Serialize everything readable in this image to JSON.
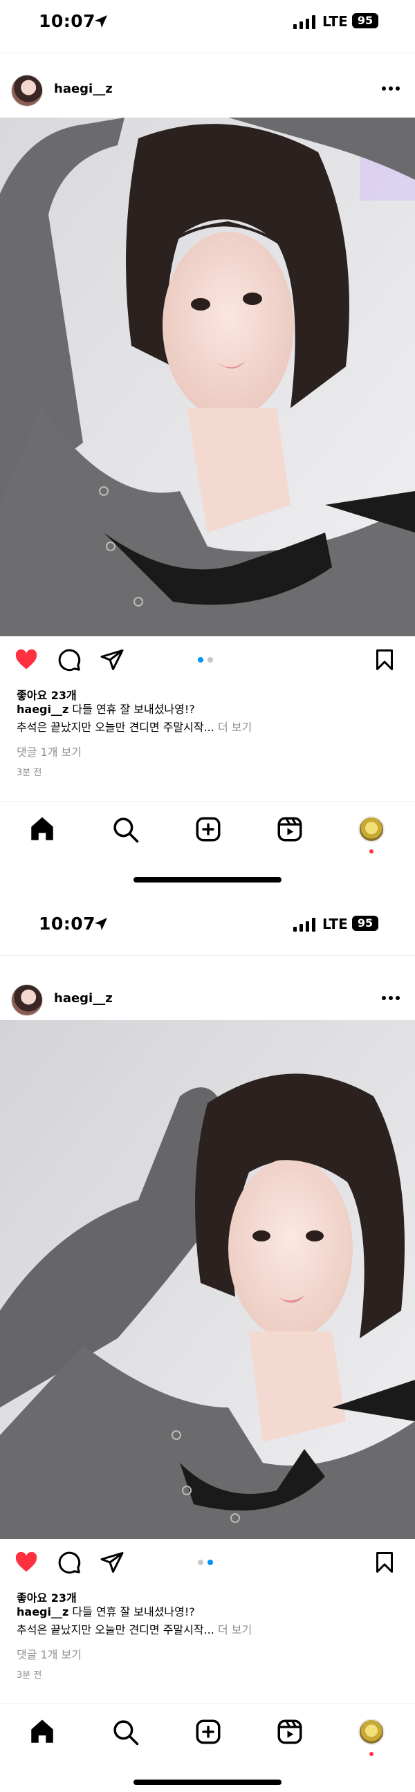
{
  "screens": [
    {
      "status": {
        "time": "10:07",
        "network": "LTE",
        "battery": "95"
      },
      "post": {
        "username": "haegi__z",
        "likes": "좋아요 23개",
        "caption_user": "haegi__z",
        "caption_line1": "다들 연휴 잘 보내셨나영!?",
        "caption_line2": "추석은 끝났지만 오늘만 견디면 주말시작...",
        "caption_more": "더 보기",
        "comments": "댓글 1개 보기",
        "time_ago": "3분 전",
        "carousel_active": 1,
        "carousel_total": 2
      }
    },
    {
      "status": {
        "time": "10:07",
        "network": "LTE",
        "battery": "95"
      },
      "post": {
        "username": "haegi__z",
        "likes": "좋아요 23개",
        "caption_user": "haegi__z",
        "caption_line1": "다들 연휴 잘 보내셨나영!?",
        "caption_line2": "추석은 끝났지만 오늘만 견디면 주말시작...",
        "caption_more": "더 보기",
        "comments": "댓글 1개 보기",
        "time_ago": "3분 전",
        "carousel_active": 2,
        "carousel_total": 2
      }
    }
  ],
  "icons": {
    "like": "heart-filled-icon",
    "comment": "comment-bubble-icon",
    "share": "paper-plane-icon",
    "save": "bookmark-icon",
    "more": "more-horizontal-icon",
    "location": "location-arrow-icon",
    "tabs": [
      "home-icon",
      "search-icon",
      "create-plus-icon",
      "reels-icon",
      "profile-avatar"
    ]
  },
  "colors": {
    "like_red": "#ff3040",
    "carousel_active": "#0095f6",
    "carousel_inactive": "#c7c7c7",
    "secondary_text": "#8e8e8e"
  }
}
